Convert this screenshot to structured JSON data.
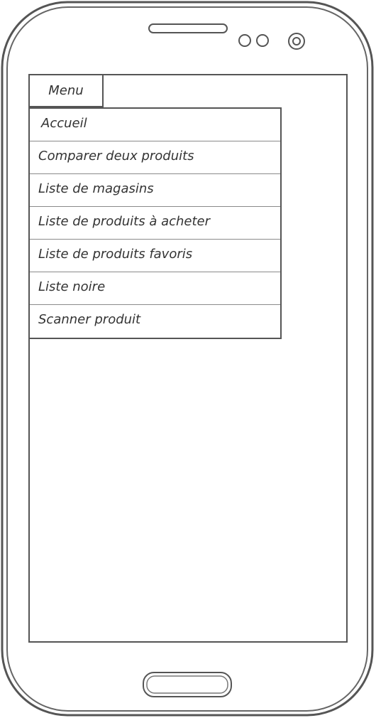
{
  "menu": {
    "button_label": "Menu",
    "items": [
      {
        "label": "Accueil"
      },
      {
        "label": "Comparer deux produits"
      },
      {
        "label": "Liste de magasins"
      },
      {
        "label": "Liste de produits à acheter"
      },
      {
        "label": "Liste de produits favoris"
      },
      {
        "label": "Liste noire"
      },
      {
        "label": "Scanner produit"
      }
    ]
  },
  "colors": {
    "outline": "#555555",
    "text": "#333333",
    "background": "#ffffff"
  },
  "icons": [
    "speaker-slot-icon",
    "sensor-icon",
    "sensor-icon",
    "front-camera-icon",
    "home-button-icon"
  ]
}
